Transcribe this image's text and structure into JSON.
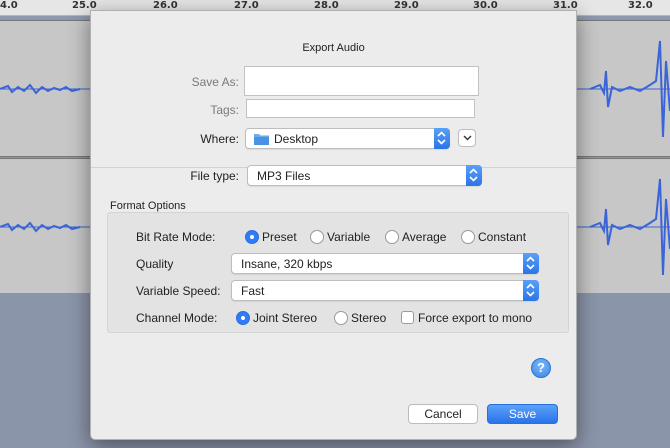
{
  "ruler": {
    "ticks": [
      "4.0",
      "25.0",
      "26.0",
      "27.0",
      "28.0",
      "29.0",
      "30.0",
      "31.0",
      "32.0"
    ]
  },
  "dialog": {
    "title": "Export Audio",
    "save_as": {
      "label": "Save As:",
      "value": ""
    },
    "tags": {
      "label": "Tags:",
      "value": ""
    },
    "where": {
      "label": "Where:",
      "value": "Desktop"
    },
    "file_type": {
      "label": "File type:",
      "value": "MP3 Files"
    },
    "format_options": {
      "title": "Format Options",
      "bit_rate_mode": {
        "label": "Bit Rate Mode:",
        "options": [
          "Preset",
          "Variable",
          "Average",
          "Constant"
        ],
        "selected": "Preset"
      },
      "quality": {
        "label": "Quality",
        "value": "Insane, 320 kbps"
      },
      "variable_speed": {
        "label": "Variable Speed:",
        "value": "Fast"
      },
      "channel_mode": {
        "label": "Channel Mode:",
        "options": [
          "Joint Stereo",
          "Stereo"
        ],
        "selected": "Joint Stereo"
      },
      "force_mono": {
        "label": "Force export to mono",
        "checked": false
      }
    },
    "help_label": "?",
    "cancel_label": "Cancel",
    "save_label": "Save"
  },
  "colors": {
    "accent": "#2f7cf6",
    "waveform": "#3a64d8",
    "track_bg": "#c7c7c7",
    "desktop_bg": "#8b95aa"
  }
}
